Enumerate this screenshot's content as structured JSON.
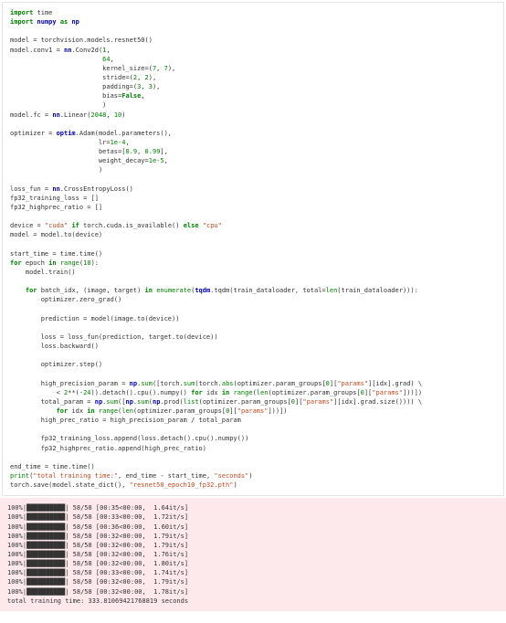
{
  "code": {
    "l1_import": "import",
    "l1_time": "time",
    "l2_import": "import",
    "l2_numpy": "numpy",
    "l2_as": "as",
    "l2_np": "np",
    "l3_blank": "",
    "l4": "model = torchvision.models.resnet50()",
    "l5a": "model.conv1 = ",
    "l5_nn": "nn",
    "l5b": ".Conv2d(",
    "l5_n1": "1",
    "l5c": ",",
    "l6_pad": "                        ",
    "l6_n": "64",
    "l6c": ",",
    "l7_pad": "                        ",
    "l7a": "kernel_size=(",
    "l7_n1": "7",
    "l7m": ", ",
    "l7_n2": "7",
    "l7b": "),",
    "l8_pad": "                        ",
    "l8a": "stride=(",
    "l8_n1": "2",
    "l8m": ", ",
    "l8_n2": "2",
    "l8b": "),",
    "l9_pad": "                        ",
    "l9a": "padding=(",
    "l9_n1": "3",
    "l9m": ", ",
    "l9_n2": "3",
    "l9b": "),",
    "l10_pad": "                        ",
    "l10a": "bias=",
    "l10_false": "False",
    "l10b": ",",
    "l11_pad": "                        ",
    "l11a": ")",
    "l12a": "model.fc = ",
    "l12_nn": "nn",
    "l12b": ".Linear(",
    "l12_n1": "2048",
    "l12m": ", ",
    "l12_n2": "10",
    "l12c": ")",
    "l13_blank": "",
    "l14a": "optimizer = ",
    "l14_optim": "optim",
    "l14b": ".Adam(model.parameters(),",
    "l15_pad": "                       ",
    "l15a": "lr=",
    "l15_n": "1e-4",
    "l15b": ",",
    "l16_pad": "                       ",
    "l16a": "betas=[",
    "l16_n1": "0.9",
    "l16m": ", ",
    "l16_n2": "0.99",
    "l16b": "],",
    "l17_pad": "                       ",
    "l17a": "weight_decay=",
    "l17_n": "1e-5",
    "l17b": ",",
    "l18_pad": "                       ",
    "l18a": ")",
    "l19_blank": "",
    "l20a": "loss_fun = ",
    "l20_nn": "nn",
    "l20b": ".CrossEntropyLoss()",
    "l21": "fp32_training_loss = []",
    "l22": "fp32_highprec_ratio = []",
    "l23_blank": "",
    "l24a": "device = ",
    "l24_s1": "\"cuda\"",
    "l24b": " ",
    "l24_if": "if",
    "l24c": " torch.cuda.is_available() ",
    "l24_else": "else",
    "l24d": " ",
    "l24_s2": "\"cpu\"",
    "l25": "model = model.to(device)",
    "l26_blank": "",
    "l27": "start_time = time.time()",
    "l28_for": "for",
    "l28a": " epoch ",
    "l28_in": "in",
    "l28b": " ",
    "l28_range": "range",
    "l28c": "(",
    "l28_n": "10",
    "l28d": "):",
    "l29_pad": "    ",
    "l29": "model.train()",
    "l30_blank": "",
    "l31_pad": "    ",
    "l31_for": "for",
    "l31a": " batch_idx, (image, target) ",
    "l31_in": "in",
    "l31b": " ",
    "l31_enum": "enumerate",
    "l31c": "(",
    "l31_tqdm": "tqdm",
    "l31d": ".tqdm(train_dataloader, total=",
    "l31_len": "len",
    "l31e": "(train_dataloader))):",
    "l32_pad": "        ",
    "l32": "optimizer.zero_grad()",
    "l33_blank": "",
    "l34_pad": "        ",
    "l34": "prediction = model(image.to(device))",
    "l35_blank": "",
    "l36_pad": "        ",
    "l36": "loss = loss_fun(prediction, target.to(device))",
    "l37_pad": "        ",
    "l37": "loss.backward()",
    "l38_blank": "",
    "l39_pad": "        ",
    "l39": "optimizer.step()",
    "l40_blank": "",
    "l41_pad": "        ",
    "l41a": "high_precision_param = ",
    "l41_np": "np",
    "l41b": ".",
    "l41_sum": "sum",
    "l41c": "([torch.",
    "l41_sum2": "sum",
    "l41d": "(torch.",
    "l41_abs": "abs",
    "l41e": "(optimizer.param_groups[",
    "l41_n0": "0",
    "l41f": "][",
    "l41_s": "\"params\"",
    "l41g": "][idx].grad) \\",
    "l42_pad": "            ",
    "l42a": "< ",
    "l42_n2": "2",
    "l42b": "**(-",
    "l42_n24": "24",
    "l42c": ")).detach().cpu().numpy() ",
    "l42_for": "for",
    "l42d": " idx ",
    "l42_in": "in",
    "l42e": " ",
    "l42_range": "range",
    "l42f": "(",
    "l42_len": "len",
    "l42g": "(optimizer.param_groups[",
    "l42_n0": "0",
    "l42h": "][",
    "l42_s": "\"params\"",
    "l42i": "]))])",
    "l43_pad": "        ",
    "l43a": "total_param = ",
    "l43_np": "np",
    "l43b": ".",
    "l43_sum": "sum",
    "l43c": "([",
    "l43_np2": "np",
    "l43d": ".",
    "l43_sum2": "sum",
    "l43e": "(",
    "l43_np3": "np",
    "l43f": ".prod(",
    "l43_list": "list",
    "l43g": "(optimizer.param_groups[",
    "l43_n0": "0",
    "l43h": "][",
    "l43_s": "\"params\"",
    "l43i": "][idx].grad.size()))) \\",
    "l44_pad": "            ",
    "l44_for": "for",
    "l44a": " idx ",
    "l44_in": "in",
    "l44b": " ",
    "l44_range": "range",
    "l44c": "(",
    "l44_len": "len",
    "l44d": "(optimizer.param_groups[",
    "l44_n0": "0",
    "l44e": "][",
    "l44_s": "\"params\"",
    "l44f": "]))])",
    "l45_pad": "        ",
    "l45": "high_prec_ratio = high_precision_param / total_param",
    "l46_blank": "",
    "l47_pad": "        ",
    "l47": "fp32_training_loss.append(loss.detach().cpu().numpy())",
    "l48_pad": "        ",
    "l48": "fp32_highprec_ratio.append(high_prec_ratio)",
    "l49_blank": "",
    "l50": "end_time = time.time()",
    "l51_print": "print",
    "l51a": "(",
    "l51_s1": "\"total training time:\"",
    "l51b": ", end_time - start_time, ",
    "l51_s2": "\"seconds\"",
    "l51c": ")",
    "l52": "torch.save(model.state_dict(), ",
    "l52_s": "\"resnet50_epoch10_fp32.pth\"",
    "l52b": ")"
  },
  "output": {
    "pct": "100%",
    "bar": "|██████████|",
    "frac": " 58/58 ",
    "lines": [
      "[00:35<00:00,  1.64it/s]",
      "[00:33<00:00,  1.72it/s]",
      "[00:36<00:00,  1.60it/s]",
      "[00:32<00:00,  1.79it/s]",
      "[00:32<00:00,  1.79it/s]",
      "[00:32<00:00,  1.76it/s]",
      "[00:32<00:00,  1.80it/s]",
      "[00:33<00:00,  1.74it/s]",
      "[00:32<00:00,  1.79it/s]",
      "[00:32<00:00,  1.78it/s]"
    ],
    "final": "total training time: 333.81069421768819 seconds"
  }
}
